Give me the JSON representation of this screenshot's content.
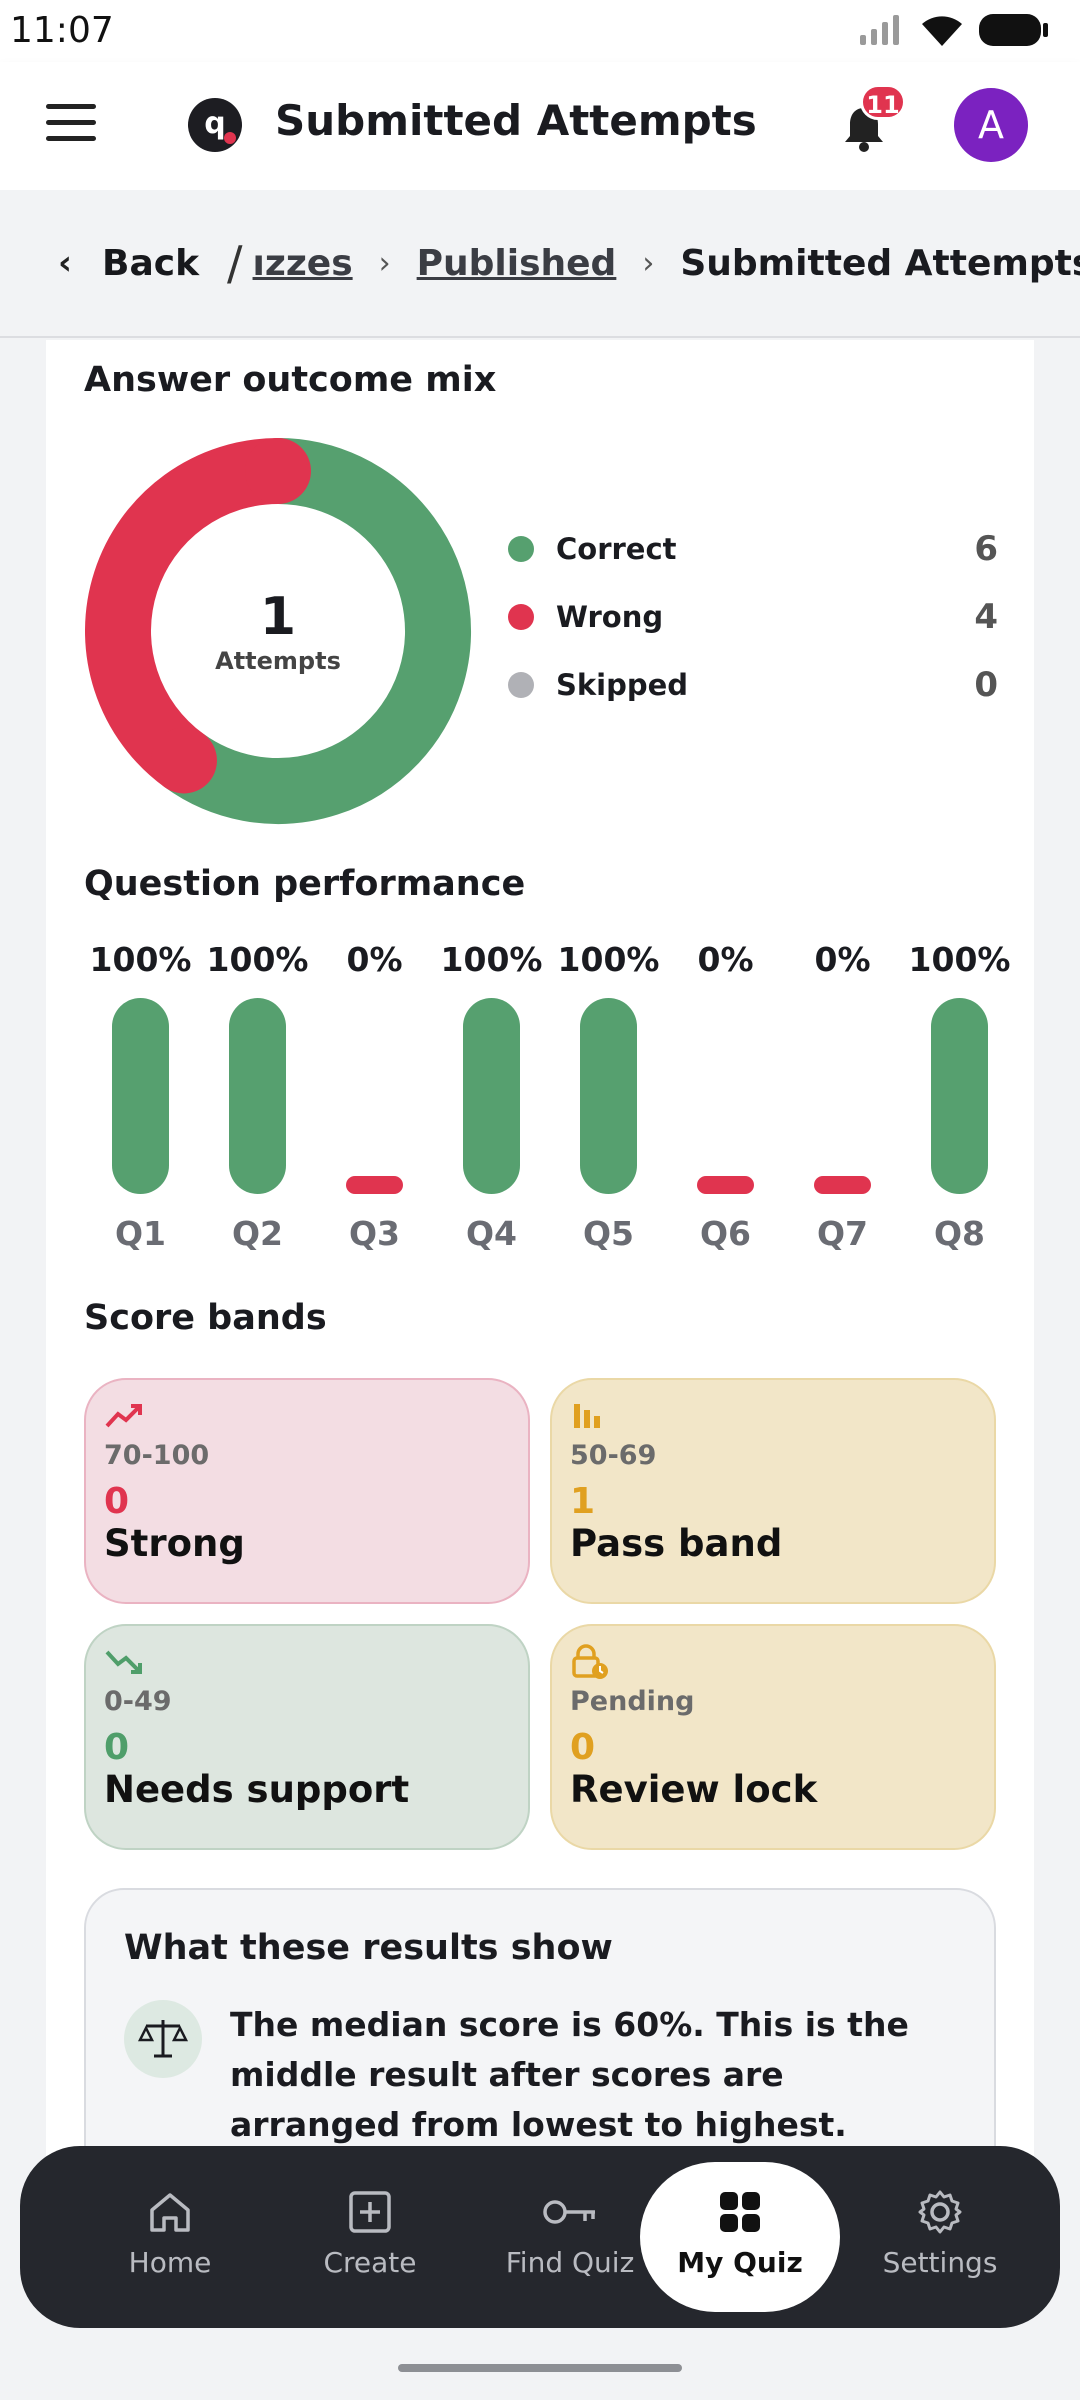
{
  "status_bar": {
    "time": "11:07"
  },
  "app_bar": {
    "title": "Submitted Attempts",
    "notification_count": "11",
    "avatar_initial": "A"
  },
  "breadcrumb": {
    "back": "Back",
    "item1": "ızzes",
    "item2": "Published",
    "current": "Submitted Attempts"
  },
  "outcome": {
    "title": "Answer outcome mix",
    "center_value": "1",
    "center_label": "Attempts",
    "legend": [
      {
        "name": "Correct",
        "count": "6",
        "color": "#56a06f"
      },
      {
        "name": "Wrong",
        "count": "4",
        "color": "#e0344f"
      },
      {
        "name": "Skipped",
        "count": "0",
        "color": "#b0b1b6"
      }
    ]
  },
  "chart_data": [
    {
      "type": "pie",
      "labels": [
        "Correct",
        "Wrong",
        "Skipped"
      ],
      "values": [
        6,
        4,
        0
      ]
    },
    {
      "type": "bar",
      "categories": [
        "Q1",
        "Q2",
        "Q3",
        "Q4",
        "Q5",
        "Q6",
        "Q7",
        "Q8"
      ],
      "values": [
        100,
        100,
        0,
        100,
        100,
        0,
        0,
        100
      ],
      "value_labels": [
        "100%",
        "100%",
        "0%",
        "100%",
        "100%",
        "0%",
        "0%",
        "100%"
      ],
      "ylim": [
        0,
        100
      ]
    }
  ],
  "performance": {
    "title": "Question performance"
  },
  "bands": {
    "title": "Score bands",
    "items": [
      {
        "range": "70-100",
        "count": "0",
        "name": "Strong",
        "icon": "trending-up-icon"
      },
      {
        "range": "50-69",
        "count": "1",
        "name": "Pass band",
        "icon": "bar-chart-icon"
      },
      {
        "range": "0-49",
        "count": "0",
        "name": "Needs support",
        "icon": "trending-down-icon"
      },
      {
        "range": "Pending",
        "count": "0",
        "name": "Review lock",
        "icon": "lock-clock-icon"
      }
    ]
  },
  "results": {
    "title": "What these results show",
    "text": "The median score is 60%. This is the middle result after scores are arranged from lowest to highest."
  },
  "nav": {
    "items": [
      {
        "label": "Home",
        "icon": "home-icon"
      },
      {
        "label": "Create",
        "icon": "plus-square-icon"
      },
      {
        "label": "Find Quiz",
        "icon": "key-icon"
      },
      {
        "label": "My Quiz",
        "icon": "grid-icon"
      },
      {
        "label": "Settings",
        "icon": "gear-icon"
      }
    ],
    "active": "My Quiz"
  },
  "colors": {
    "correct": "#56a06f",
    "wrong": "#e0344f",
    "skipped": "#b0b1b6",
    "accent_purple": "#7b22c0"
  }
}
